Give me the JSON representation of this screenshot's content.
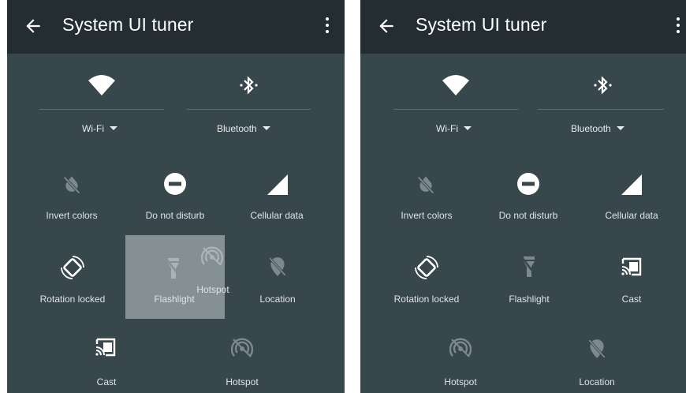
{
  "left_panel": {
    "title": "System UI tuner",
    "wifi_label": "Wi-Fi",
    "bluetooth_label": "Bluetooth",
    "tiles": {
      "invert": "Invert colors",
      "dnd": "Do not disturb",
      "cellular": "Cellular data",
      "rotation": "Rotation locked",
      "flashlight": "Flashlight",
      "hotspot_drag": "Hotspot",
      "location": "Location",
      "cast": "Cast",
      "hotspot": "Hotspot"
    }
  },
  "right_panel": {
    "title": "System UI tuner",
    "wifi_label": "Wi-Fi",
    "bluetooth_label": "Bluetooth",
    "tiles": {
      "invert": "Invert colors",
      "dnd": "Do not disturb",
      "cellular": "Cellular data",
      "rotation": "Rotation locked",
      "flashlight": "Flashlight",
      "cast": "Cast",
      "hotspot": "Hotspot",
      "location": "Location"
    }
  },
  "colors": {
    "app_bar": "#242e32",
    "panel_bg": "#37474c",
    "icon_active": "#ffffff",
    "icon_inactive": "#7c8a8f"
  }
}
